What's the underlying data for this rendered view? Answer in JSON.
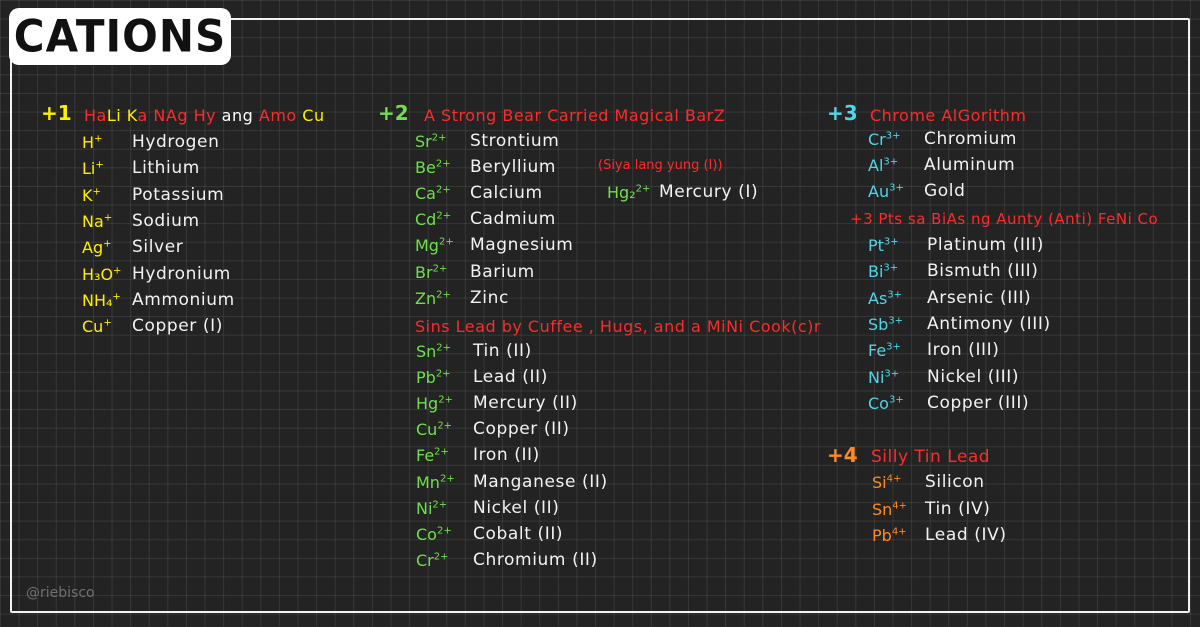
{
  "title": "CATIONS",
  "watermark": "@riebisco",
  "colors": {
    "background": "#232323",
    "grid": "#3a3a3a",
    "mnemonic": "#ff2a2a",
    "plus1": "#ffee00",
    "plus2": "#6fe04a",
    "plus3": "#4fd6e8",
    "plus4": "#ff8a1f",
    "text": "#f2f2f2"
  },
  "plus1": {
    "charge": "+1",
    "mnemonic_parts": [
      "Ha",
      "Li",
      " ",
      "K",
      "a",
      " ",
      "NAg",
      " ",
      "Hy",
      " ang ",
      "Amo",
      " ",
      "Cu"
    ],
    "ions": [
      {
        "symbol": "H",
        "charge": "+",
        "name": "Hydrogen"
      },
      {
        "symbol": "Li",
        "charge": "+",
        "name": "Lithium"
      },
      {
        "symbol": "K",
        "charge": "+",
        "name": "Potassium"
      },
      {
        "symbol": "Na",
        "charge": "+",
        "name": "Sodium"
      },
      {
        "symbol": "Ag",
        "charge": "+",
        "name": "Silver"
      },
      {
        "symbol": "H₃O",
        "charge": "+",
        "name": "Hydronium"
      },
      {
        "symbol": "NH₄",
        "charge": "+",
        "name": "Ammonium"
      },
      {
        "symbol": "Cu",
        "charge": "+",
        "name": "Copper (I)"
      }
    ]
  },
  "plus2": {
    "charge": "+2",
    "mnemonic": "A Strong Bear Carried Magical BarZ",
    "ions": [
      {
        "symbol": "Sr",
        "charge": "2+",
        "name": "Strontium"
      },
      {
        "symbol": "Be",
        "charge": "2+",
        "name": "Beryllium"
      },
      {
        "symbol": "Ca",
        "charge": "2+",
        "name": "Calcium"
      },
      {
        "symbol": "Cd",
        "charge": "2+",
        "name": "Cadmium"
      },
      {
        "symbol": "Mg",
        "charge": "2+",
        "name": "Magnesium"
      },
      {
        "symbol": "Br",
        "charge": "2+",
        "name": "Barium"
      },
      {
        "symbol": "Zn",
        "charge": "2+",
        "name": "Zinc"
      }
    ],
    "note": "(Siya lang yung (I))",
    "special_ion": {
      "symbol": "Hg₂",
      "charge": "2+",
      "name": "Mercury (I)"
    },
    "mnemonic2": "Sins Lead by Cuffee , Hugs, and a MiNi Cook(c)r",
    "ions2": [
      {
        "symbol": "Sn",
        "charge": "2+",
        "name": "Tin (II)"
      },
      {
        "symbol": "Pb",
        "charge": "2+",
        "name": "Lead (II)"
      },
      {
        "symbol": "Hg",
        "charge": "2+",
        "name": "Mercury (II)"
      },
      {
        "symbol": "Cu",
        "charge": "2+",
        "name": "Copper (II)"
      },
      {
        "symbol": "Fe",
        "charge": "2+",
        "name": "Iron (II)"
      },
      {
        "symbol": "Mn",
        "charge": "2+",
        "name": "Manganese (II)"
      },
      {
        "symbol": "Ni",
        "charge": "2+",
        "name": "Nickel (II)"
      },
      {
        "symbol": "Co",
        "charge": "2+",
        "name": "Cobalt (II)"
      },
      {
        "symbol": "Cr",
        "charge": "2+",
        "name": "Chromium (II)"
      }
    ]
  },
  "plus3": {
    "charge": "+3",
    "mnemonic": "Chrome AlGorithm",
    "ions": [
      {
        "symbol": "Cr",
        "charge": "3+",
        "name": "Chromium"
      },
      {
        "symbol": "Al",
        "charge": "3+",
        "name": "Aluminum"
      },
      {
        "symbol": "Au",
        "charge": "3+",
        "name": "Gold"
      }
    ],
    "mnemonic2": "+3 Pts sa BiAs ng Aunty (Anti) FeNi Co",
    "ions2": [
      {
        "symbol": "Pt",
        "charge": "3+",
        "name": "Platinum (III)"
      },
      {
        "symbol": "Bi",
        "charge": "3+",
        "name": "Bismuth (III)"
      },
      {
        "symbol": "As",
        "charge": "3+",
        "name": "Arsenic (III)"
      },
      {
        "symbol": "Sb",
        "charge": "3+",
        "name": "Antimony (III)"
      },
      {
        "symbol": "Fe",
        "charge": "3+",
        "name": "Iron (III)"
      },
      {
        "symbol": "Ni",
        "charge": "3+",
        "name": "Nickel (III)"
      },
      {
        "symbol": "Co",
        "charge": "3+",
        "name": "Copper (III)"
      }
    ]
  },
  "plus4": {
    "charge": "+4",
    "mnemonic": "Silly Tin Lead",
    "ions": [
      {
        "symbol": "Si",
        "charge": "4+",
        "name": "Silicon"
      },
      {
        "symbol": "Sn",
        "charge": "4+",
        "name": "Tin (IV)"
      },
      {
        "symbol": "Pb",
        "charge": "4+",
        "name": "Lead (IV)"
      }
    ]
  }
}
